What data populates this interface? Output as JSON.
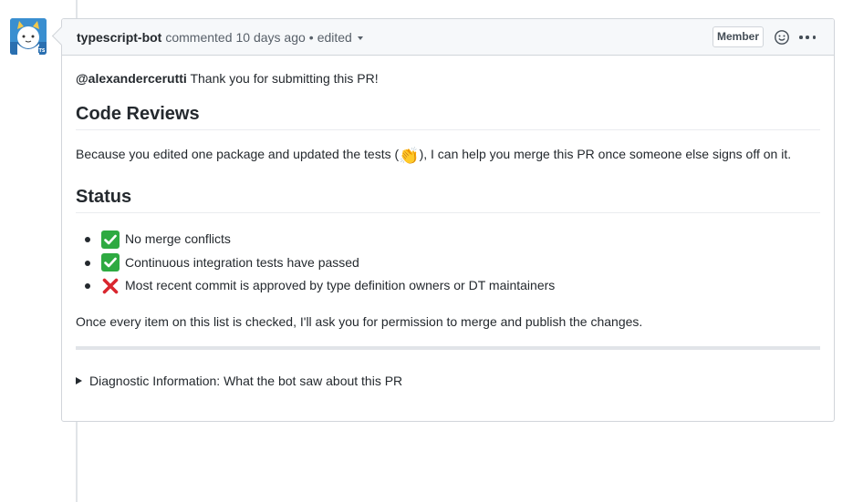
{
  "comment": {
    "author": "typescript-bot",
    "action": "commented",
    "time": "10 days ago",
    "separator": "•",
    "edited": "edited",
    "badge": "Member"
  },
  "body": {
    "mention": "@alexandercerutti",
    "intro": " Thank you for submitting this PR!",
    "heading_reviews": "Code Reviews",
    "reviews_text_before": "Because you edited one package and updated the tests (",
    "reviews_emoji": "👏",
    "reviews_text_after": "), I can help you merge this PR once someone else signs off on it.",
    "heading_status": "Status",
    "status_items": [
      {
        "icon": "check-icon",
        "text": "No merge conflicts"
      },
      {
        "icon": "check-icon",
        "text": "Continuous integration tests have passed"
      },
      {
        "icon": "cross-icon",
        "text": "Most recent commit is approved by type definition owners or DT maintainers"
      }
    ],
    "closing": "Once every item on this list is checked, I'll ask you for permission to merge and publish the changes.",
    "details_summary": "Diagnostic Information: What the bot saw about this PR"
  },
  "colors": {
    "check": "#2eaa41",
    "cross": "#d9262e",
    "avatar_bg": "#3a8fd0"
  }
}
